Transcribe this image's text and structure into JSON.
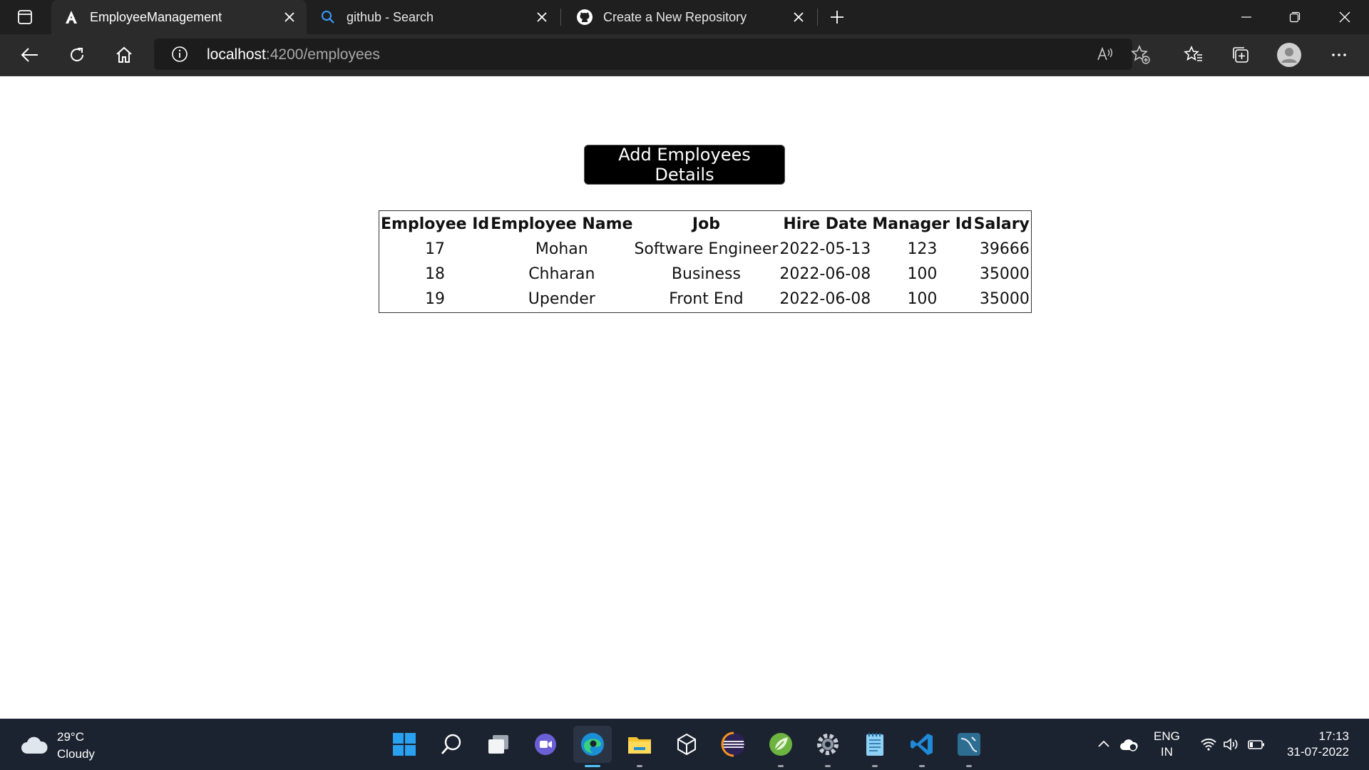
{
  "browser": {
    "tabs": [
      {
        "title": "EmployeeManagement",
        "icon": "angular-icon",
        "active": true
      },
      {
        "title": "github - Search",
        "icon": "search-icon",
        "active": false
      },
      {
        "title": "Create a New Repository",
        "icon": "github-icon",
        "active": false
      }
    ],
    "address": {
      "host": "localhost",
      "path": ":4200/employees"
    }
  },
  "page": {
    "add_button_label": "Add Employees Details",
    "table": {
      "headers": [
        "Employee Id",
        "Employee Name",
        "Job",
        "Hire Date",
        "Manager Id",
        "Salary"
      ],
      "rows": [
        [
          "17",
          "Mohan",
          "Software Engineer",
          "2022-05-13",
          "123",
          "39666"
        ],
        [
          "18",
          "Chharan",
          "Business",
          "2022-06-08",
          "100",
          "35000"
        ],
        [
          "19",
          "Upender",
          "Front End",
          "2022-06-08",
          "100",
          "35000"
        ]
      ]
    }
  },
  "taskbar": {
    "weather": {
      "temp": "29°C",
      "desc": "Cloudy"
    },
    "language": {
      "line1": "ENG",
      "line2": "IN"
    },
    "clock": {
      "time": "17:13",
      "date": "31-07-2022"
    }
  },
  "colors": {
    "accent": "#4fc3f7",
    "button_bg": "#000000",
    "tabstrip": "#1f1f1f",
    "taskbar": "#1c2330"
  }
}
